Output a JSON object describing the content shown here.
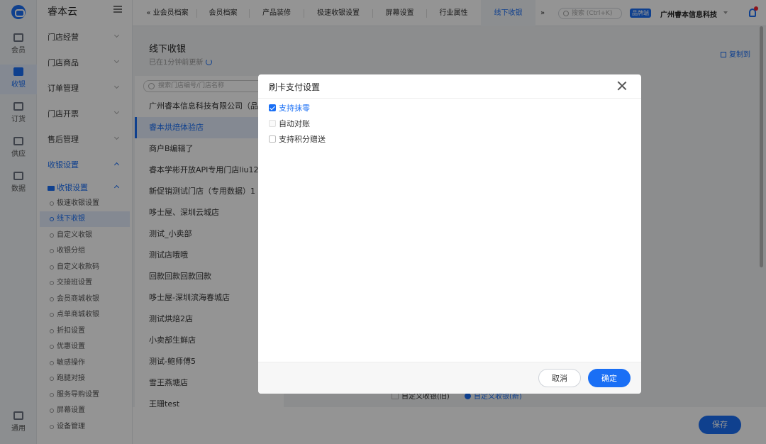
{
  "app": {
    "brand": "睿本云"
  },
  "rail": [
    {
      "label": "会员",
      "icon": "member-card-icon"
    },
    {
      "label": "收银",
      "icon": "cashier-icon",
      "active": true
    },
    {
      "label": "订货",
      "icon": "order-icon"
    },
    {
      "label": "供应",
      "icon": "truck-icon"
    },
    {
      "label": "数据",
      "icon": "chart-icon"
    },
    {
      "label": "通用",
      "icon": "share-icon"
    }
  ],
  "menu": {
    "groups": [
      "门店经营",
      "门店商品",
      "订单管理",
      "门店开票",
      "售后管理",
      "收银设置"
    ],
    "folder_label": "收银设置",
    "subitems": [
      "极速收银设置",
      "线下收银",
      "自定义收银",
      "收银分组",
      "自定义收款码",
      "交接班设置",
      "会员商城收银",
      "点单商城收银",
      "折扣设置",
      "优惠设置",
      "敏感操作",
      "跑腿对接",
      "服务导购设置",
      "屏幕设置",
      "设备管理"
    ]
  },
  "tabs": [
    "业会员档案",
    "会员档案",
    "产品装修",
    "极速收银设置",
    "屏幕设置",
    "行业属性",
    "线下收银"
  ],
  "topbar": {
    "search_placeholder": "搜索 (Ctrl+K)",
    "badge": "品牌端",
    "company": "广州睿本信息科技"
  },
  "page": {
    "title": "线下收银",
    "updated": "已在1分钟前更新",
    "copy_to": "复制到",
    "store_search_placeholder": "搜索门店编号/门店名称",
    "stores": [
      "广州睿本信息科技有限公司（品",
      "睿本烘焙体验店",
      "商户B编辑了",
      "睿本学彬开放API专用门店liu12",
      "新促销测试门店（专用数据）1",
      "哆士屋、深圳云城店",
      "测试_小卖部",
      "测试店哦哦",
      "回款回款回款回款",
      "哆士屋-深圳滨海春城店",
      "测试烘焙2店",
      "小卖部生鲜店",
      "测试-鲍师傅5",
      "雪王燕塘店",
      "王珊test"
    ],
    "bottom_option_old": "自定义收银(旧)",
    "bottom_option_new": "自定义收银(新)",
    "save": "保存"
  },
  "dialog": {
    "title": "刷卡支付设置",
    "options": [
      {
        "label": "支持抹零",
        "checked": true
      },
      {
        "label": "自动对账",
        "checked": false,
        "disabled": true
      },
      {
        "label": "支持积分赠送",
        "checked": false
      }
    ],
    "cancel": "取消",
    "ok": "确定"
  }
}
